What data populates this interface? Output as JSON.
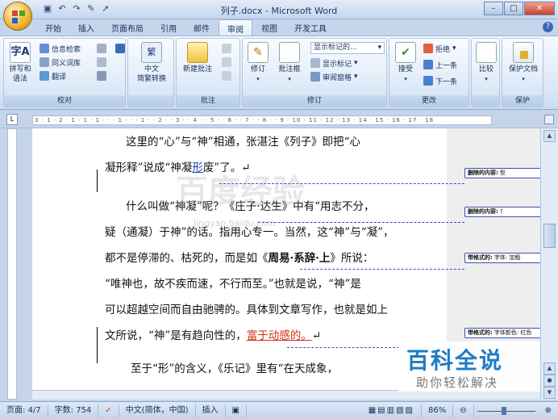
{
  "window": {
    "title": "列子.docx - Microsoft Word",
    "controls": {
      "minimize": "–",
      "maximize": "□",
      "close": "✕"
    }
  },
  "quick_access": [
    "save-icon",
    "undo-icon",
    "redo-icon",
    "format-painter-icon",
    "pointer-icon"
  ],
  "tabs": [
    {
      "label": "开始"
    },
    {
      "label": "插入"
    },
    {
      "label": "页面布局"
    },
    {
      "label": "引用"
    },
    {
      "label": "邮件"
    },
    {
      "label": "审阅",
      "active": true
    },
    {
      "label": "视图"
    },
    {
      "label": "开发工具"
    }
  ],
  "ribbon": {
    "proofing": {
      "label": "校对",
      "spelling": "拼写和\n语法",
      "research": "信息检索",
      "thesaurus": "同义词库",
      "translate": "翻译"
    },
    "chinese": {
      "label": "",
      "convert": "中文\n简繁转换"
    },
    "comments": {
      "label": "批注",
      "new_comment": "新建批注"
    },
    "tracking": {
      "label": "修订",
      "track_changes": "修订",
      "balloons": "批注框",
      "display_for_review": "显示标记的...",
      "show_markup": "显示标记",
      "reviewing_pane": "审阅窗格"
    },
    "changes": {
      "label": "更改",
      "accept": "接受",
      "reject": "拒绝",
      "previous": "上一条",
      "next": "下一条"
    },
    "compare": {
      "label": "",
      "compare": "比较"
    },
    "protect": {
      "label": "保护",
      "protect_document": "保护文档"
    }
  },
  "ruler": {
    "tab_selector": "L",
    "ticks": "3 · 1 · 2 · 1 · 1 · 1 · · · 1 · · · 1 · · 2 · · 3 · · 4 · · 5 · · 6 · · 7 · · 8 · · 9 · 10 · 11 · 12 · 13 · 14 · 15 · 16 · 17 · 18"
  },
  "document": {
    "paragraphs": [
      {
        "lines": [
          {
            "parts": [
              {
                "t": "这里的“心”与“神”相通，张湛注《列子》即把“心"
              }
            ]
          },
          {
            "parts": [
              {
                "t": "凝形释”说成“神凝"
              },
              {
                "t": "形",
                "style": "ins"
              },
              {
                "t": "废”了。↵"
              }
            ]
          }
        ]
      },
      {
        "lines": [
          {
            "parts": [
              {
                "t": "什么叫做“神凝”呢？《庄子·达生》中有“用志不分，"
              }
            ]
          },
          {
            "parts": [
              {
                "t": "疑（通凝）于神”的话。指用心专一。当然，这“神”与“凝”，"
              }
            ]
          },
          {
            "parts": [
              {
                "t": "都不是停滞的、枯死的，而是如《"
              },
              {
                "t": "周易·系辞·上",
                "style": "bold"
              },
              {
                "t": "》所说："
              }
            ]
          },
          {
            "parts": [
              {
                "t": "“唯神也，故不疾而速，不行而至。”也就是说，“神”是"
              }
            ]
          },
          {
            "parts": [
              {
                "t": "可以超越空间而自由驰骋的。具体到文章写作，也就是如上"
              }
            ]
          },
          {
            "parts": [
              {
                "t": "文所说，“神”是有趋向性的，"
              },
              {
                "t": "富于动感的。",
                "style": "mod"
              },
              {
                "t": "↵"
              }
            ]
          }
        ]
      },
      {
        "lines": [
          {
            "parts": [
              {
                "t": "至于“形”的含义，《乐记》里有“在天成象，"
              }
            ]
          }
        ]
      }
    ],
    "balloons": [
      {
        "label": "删除的内容:",
        "value": "型"
      },
      {
        "label": "删除的内容:",
        "value": "?"
      },
      {
        "label": "带格式的:",
        "value": "字体: 加粗"
      },
      {
        "label": "带格式的:",
        "value": "字体颜色: 红色"
      }
    ]
  },
  "watermark": {
    "title": "百科全说",
    "subtitle": "助你轻松解决",
    "ghost": "百度经验",
    "url": "jingyan.baidu.com"
  },
  "status": {
    "page": "页面: 4/7",
    "words": "字数: 754",
    "language": "中文(简体，中国)",
    "mode": "插入",
    "zoom": "86%"
  },
  "colors": {
    "insertion": "#1a3ebc",
    "format_change": "#d03010",
    "balloon_border": "#3c50b0",
    "watermark_blue": "#1e7cc6"
  }
}
